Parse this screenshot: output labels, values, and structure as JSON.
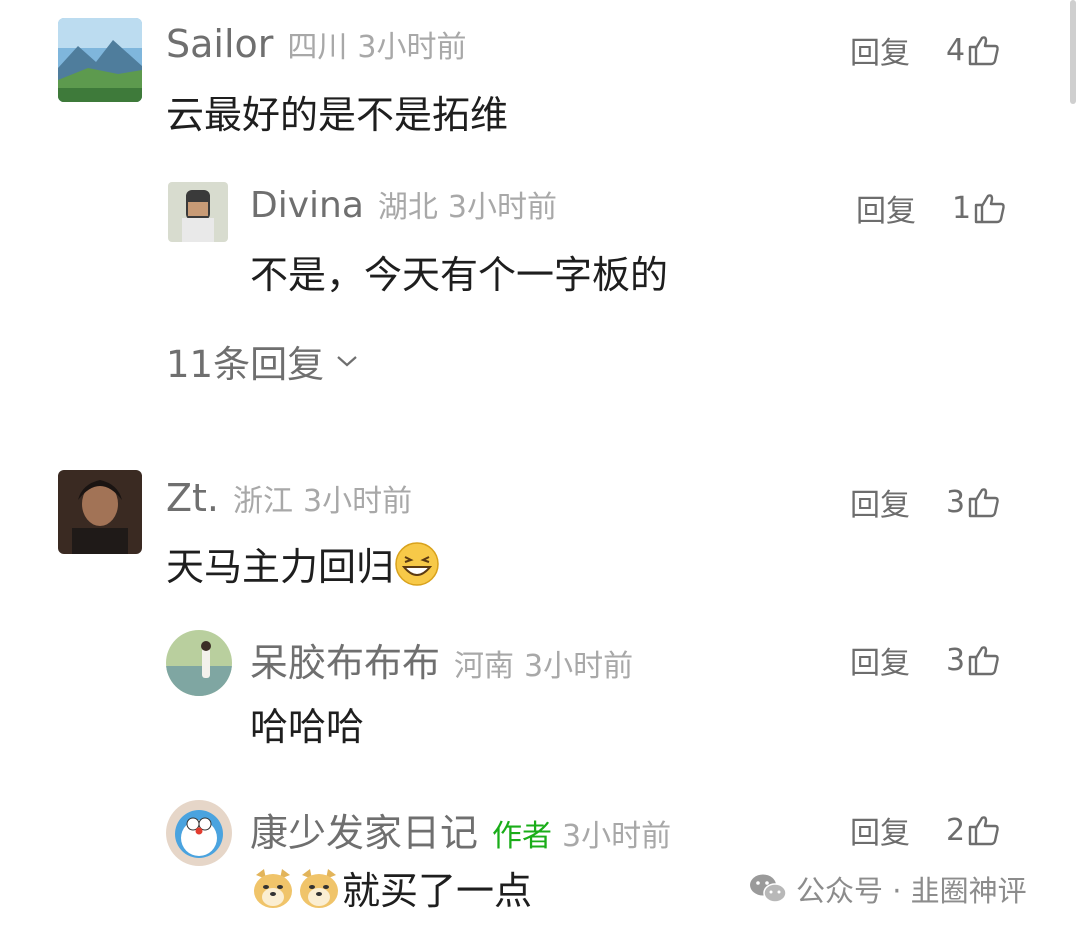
{
  "comments": [
    {
      "name": "Sailor",
      "location": "四川",
      "time": "3小时前",
      "reply_label": "回复",
      "likes": "4",
      "text": "云最好的是不是拓维",
      "replies": [
        {
          "name": "Divina",
          "location": "湖北",
          "time": "3小时前",
          "reply_label": "回复",
          "likes": "1",
          "text": "不是，今天有个一字板的"
        }
      ],
      "more_replies": "11条回复"
    },
    {
      "name": "Zt.",
      "location": "浙江",
      "time": "3小时前",
      "reply_label": "回复",
      "likes": "3",
      "text": "天马主力回归",
      "text_emoji": "grinning-squint-emoji",
      "replies": [
        {
          "name": "呆胶布布布",
          "location": "河南",
          "time": "3小时前",
          "reply_label": "回复",
          "likes": "3",
          "text": "哈哈哈"
        },
        {
          "name": "康少发家日记",
          "badge": "作者",
          "time": "3小时前",
          "reply_label": "回复",
          "likes": "2",
          "text": "就买了一点",
          "text_emoji": "doge-emoji"
        }
      ]
    }
  ],
  "watermark": {
    "text": "公众号 · 韭圈神评",
    "icon": "wechat-icon"
  },
  "colors": {
    "author_badge": "#1aad19",
    "name": "#6f6f6f",
    "meta": "#a8a8a8"
  }
}
